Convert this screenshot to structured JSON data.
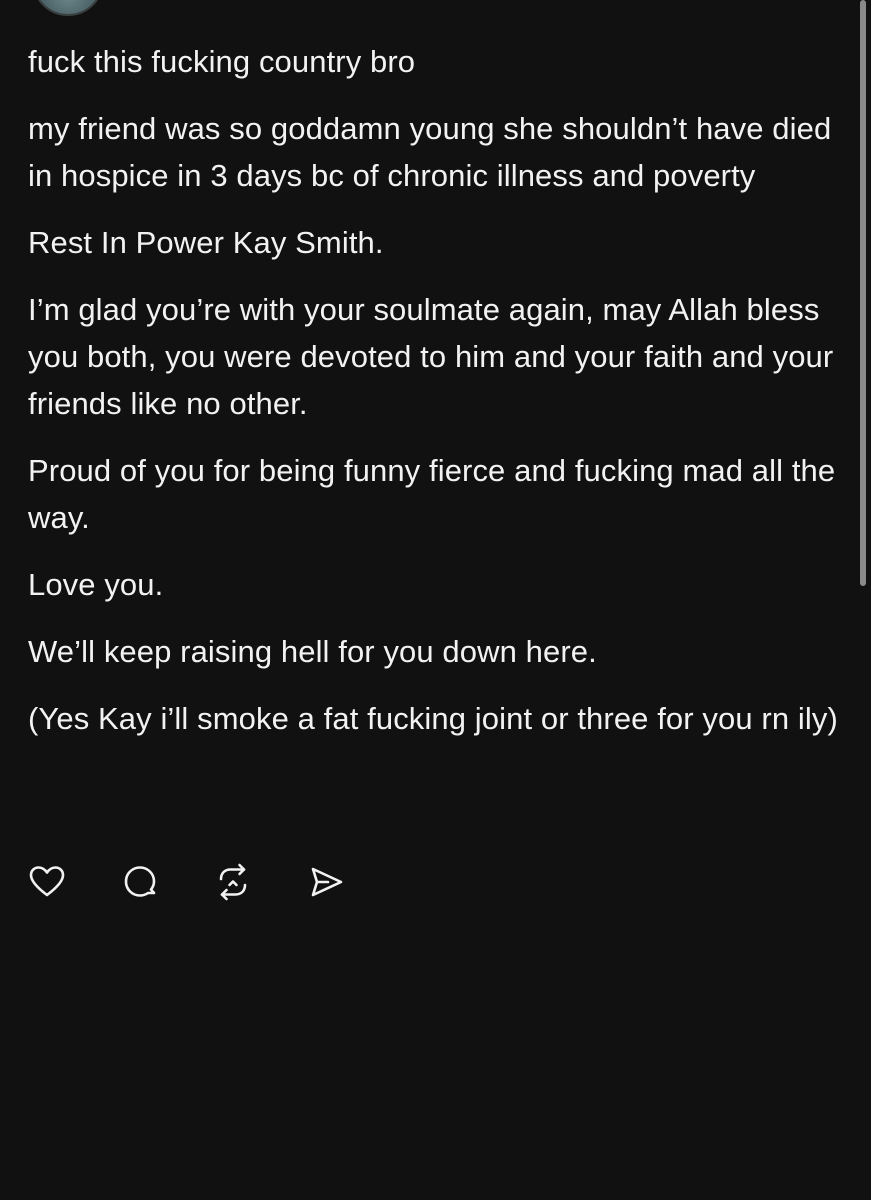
{
  "post": {
    "paragraphs": [
      "fuck this fucking country bro",
      "my friend was so goddamn young she shouldn’t have died in hospice in 3 days bc of chronic illness and poverty",
      "Rest In Power Kay Smith.",
      "I’m glad you’re with your soulmate again, may Allah bless you both, you were devoted to him and your faith and your friends like no other.",
      "Proud of you for being funny fierce and fucking mad all the way.",
      "Love you.",
      "We’ll keep raising hell for you down here.",
      "(Yes Kay i’ll smoke a fat fucking joint or three for you rn ily)"
    ]
  },
  "actions": {
    "items": [
      {
        "name": "like",
        "icon": "heart-icon"
      },
      {
        "name": "reply",
        "icon": "comment-bubble-icon"
      },
      {
        "name": "repost",
        "icon": "repost-arrows-icon"
      },
      {
        "name": "share",
        "icon": "send-paper-plane-icon"
      }
    ]
  },
  "colors": {
    "background": "#111111",
    "text": "#f2f2f2",
    "scrollbar": "#8a8a8a"
  }
}
